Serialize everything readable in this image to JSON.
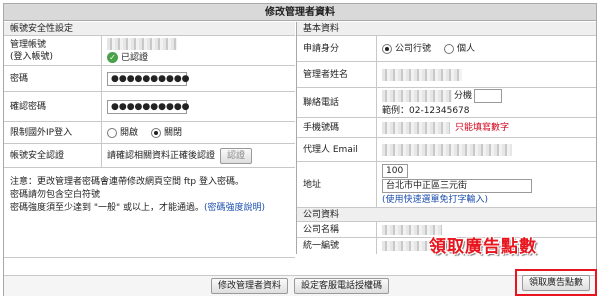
{
  "page_title": "修改管理者資料",
  "left": {
    "section_title": "帳號安全性設定",
    "account": {
      "label": "管理帳號\n(登入帳號)",
      "status": "已認證"
    },
    "password": {
      "label": "密碼",
      "value": "●●●●●●●●●●"
    },
    "confirm_password": {
      "label": "確認密碼",
      "value": "●●●●●●●●●●"
    },
    "restrict_login": {
      "label": "限制國外IP登入",
      "options": [
        "開啟",
        "關閉"
      ],
      "selected": "關閉"
    },
    "security_auth": {
      "label": "帳號安全認證",
      "text": "請確認相關資料正確後認證",
      "button": "認證"
    },
    "notes": {
      "line1": "注意：更改管理者密碼會連帶修改網頁空間 ftp 登入密碼。",
      "line2": "密碼請勿包含空白符號",
      "line3": "密碼強度須至少達到 \"一般\" 或以上，才能通過。",
      "link": "(密碼強度說明)"
    }
  },
  "right": {
    "section_title": "基本資料",
    "identity": {
      "label": "申請身分",
      "options": [
        "公司行號",
        "個人"
      ],
      "selected": "公司行號"
    },
    "manager_name": {
      "label": "管理者姓名"
    },
    "phone": {
      "label": "聯絡電話",
      "ext_label": "分機",
      "example": "範例：02-12345678"
    },
    "mobile": {
      "label": "手機號碼",
      "hint": "只能填寫數字"
    },
    "agent": {
      "label": "代理人 Email"
    },
    "address": {
      "label": "地址",
      "zip": "100",
      "city": "台北市中正區三元街",
      "link": "(使用快速選單免打字輸入)"
    },
    "company_section_title": "公司資料",
    "company_name": {
      "label": "公司名稱"
    },
    "tax_id": {
      "label": "統一編號"
    }
  },
  "buttons": {
    "save": "修改管理者資料",
    "support": "設定客服電話授權碼",
    "ad_points": "領取廣告點數"
  },
  "promo_text": "領取廣告點數",
  "colors": {
    "header_bg": "#d9d9d9",
    "highlight": "#e8141e",
    "link": "#1c4fae"
  }
}
